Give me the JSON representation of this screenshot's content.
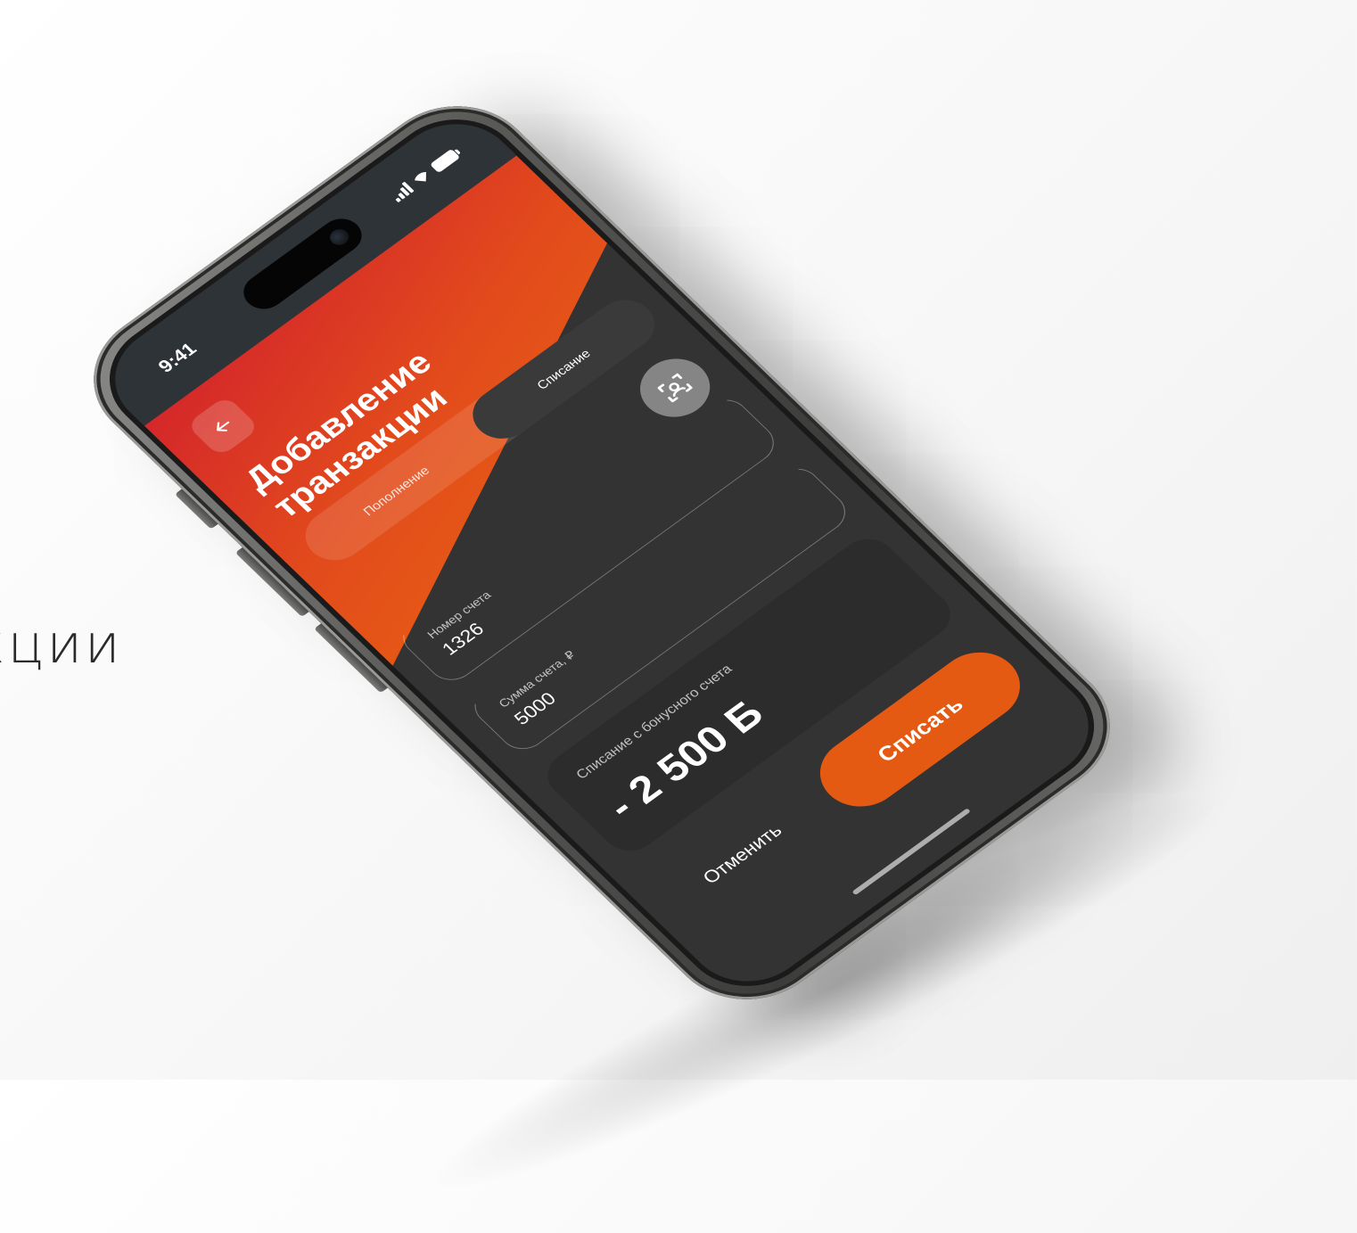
{
  "background": {
    "caption": "кции",
    "color": "#f4f4f4"
  },
  "status_bar": {
    "time": "9:41",
    "icons": [
      "signal-icon",
      "wifi-icon",
      "battery-icon"
    ]
  },
  "header": {
    "back_icon": "arrow-left-icon",
    "title": "Добавление транзакции",
    "gradient": [
      "#d4262b",
      "#e9650f"
    ]
  },
  "segmented": {
    "options": [
      {
        "label": "Пополнение",
        "selected": false
      },
      {
        "label": "Списание",
        "selected": true
      }
    ]
  },
  "scan_icon": "scan-icon",
  "form": {
    "fields": [
      {
        "label": "Номер счета",
        "value": "1326"
      },
      {
        "label": "Сумма счета, ₽",
        "value": "5000"
      }
    ],
    "bonus": {
      "label": "Списание с бонусного счета",
      "amount": "- 2 500 Б"
    }
  },
  "actions": {
    "cancel_label": "Отменить",
    "submit_label": "Списать",
    "accent": "#e55a12"
  },
  "colors": {
    "screen_bg": "#333333",
    "card_bg": "#2c2c2c"
  }
}
